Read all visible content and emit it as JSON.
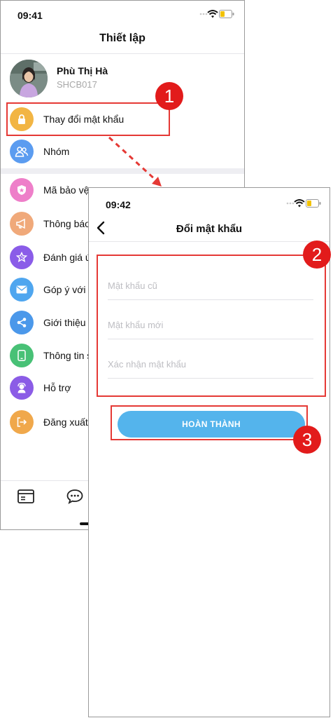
{
  "colors": {
    "highlight": "#e53935",
    "badge": "#e21b1b",
    "button": "#54b4ec",
    "separator": "#eeeef2"
  },
  "settings_screen": {
    "status_time": "09:41",
    "title": "Thiết lập",
    "profile": {
      "name": "Phù Thị Hà",
      "code": "SHCB017"
    },
    "items": [
      {
        "label": "Thay đổi mật khẩu",
        "icon": "lock-icon",
        "color": "#f2b544"
      },
      {
        "label": "Nhóm",
        "icon": "group-icon",
        "color": "#5b9cf0"
      },
      {
        "label": "Mã bảo vệ",
        "icon": "shield-icon",
        "color": "#ee7fc9"
      },
      {
        "label": "Thông báo",
        "icon": "megaphone-icon",
        "color": "#f0a97a"
      },
      {
        "label": "Đánh giá ứ",
        "icon": "star-icon",
        "color": "#8a5ce8"
      },
      {
        "label": "Góp ý với n",
        "icon": "mail-icon",
        "color": "#4fa6ef"
      },
      {
        "label": "Giới thiệu c",
        "icon": "share-icon",
        "color": "#4b98ea"
      },
      {
        "label": "Thông tin s",
        "icon": "phone-icon",
        "color": "#48c176"
      },
      {
        "label": "Hỗ trợ",
        "icon": "support-icon",
        "color": "#8b5ce6"
      },
      {
        "label": "Đăng xuất",
        "icon": "logout-icon",
        "color": "#f0a84b"
      }
    ]
  },
  "password_screen": {
    "status_time": "09:42",
    "title": "Đổi mật khẩu",
    "fields": {
      "old_password_placeholder": "Mật khẩu cũ",
      "new_password_placeholder": "Mật khẩu mới",
      "confirm_password_placeholder": "Xác nhận mật khẩu"
    },
    "submit_label": "HOÀN THÀNH"
  },
  "annotations": {
    "badge_1": "1",
    "badge_2": "2",
    "badge_3": "3"
  }
}
